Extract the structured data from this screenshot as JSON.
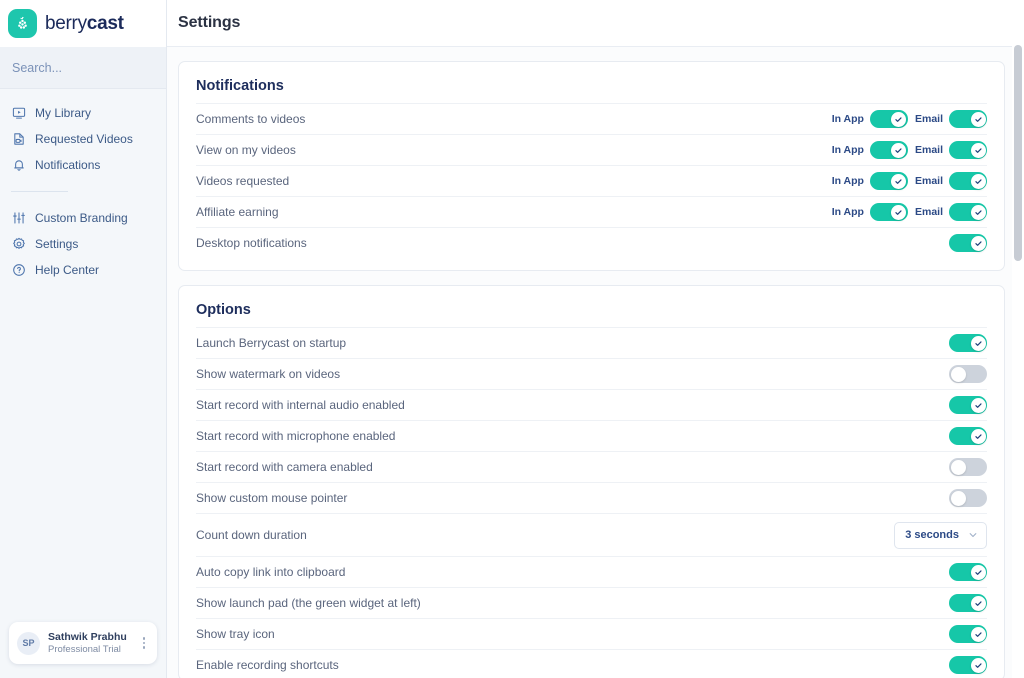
{
  "brand": {
    "name_light": "berry",
    "name_bold": "cast",
    "logo_icon": "grape-cluster-icon",
    "logo_color": "#1ec6ad"
  },
  "sidebar": {
    "search": {
      "placeholder": "Search...",
      "value": ""
    },
    "primary_items": [
      {
        "label": "My Library",
        "icon": "video-library-icon"
      },
      {
        "label": "Requested Videos",
        "icon": "requested-video-file-icon"
      },
      {
        "label": "Notifications",
        "icon": "bell-icon"
      }
    ],
    "secondary_items": [
      {
        "label": "Custom Branding",
        "icon": "sliders-icon"
      },
      {
        "label": "Settings",
        "icon": "gear-icon"
      },
      {
        "label": "Help Center",
        "icon": "question-circle-icon"
      }
    ],
    "profile": {
      "initials": "SP",
      "name": "Sathwik Prabhu",
      "plan": "Professional Trial",
      "menu_icon": "kebab-menu-icon"
    }
  },
  "header": {
    "title": "Settings"
  },
  "colors": {
    "accent_teal": "#16c7a8",
    "toggle_off": "#cdd3dc",
    "brand_navy": "#1d2d5c",
    "link_blue": "#2c4a86"
  },
  "notifications_card": {
    "title": "Notifications",
    "in_app_label": "In App",
    "email_label": "Email",
    "rows": [
      {
        "label": "Comments to videos",
        "in_app": true,
        "email": true,
        "has_channels": true
      },
      {
        "label": "View on my videos",
        "in_app": true,
        "email": true,
        "has_channels": true
      },
      {
        "label": "Videos requested",
        "in_app": true,
        "email": true,
        "has_channels": true
      },
      {
        "label": "Affiliate earning",
        "in_app": true,
        "email": true,
        "has_channels": true
      },
      {
        "label": "Desktop notifications",
        "enabled": true,
        "has_channels": false
      }
    ]
  },
  "options_card": {
    "title": "Options",
    "rows": [
      {
        "label": "Launch Berrycast on startup",
        "type": "toggle",
        "enabled": true
      },
      {
        "label": "Show watermark on videos",
        "type": "toggle",
        "enabled": false
      },
      {
        "label": "Start record with internal audio enabled",
        "type": "toggle",
        "enabled": true
      },
      {
        "label": "Start record with microphone enabled",
        "type": "toggle",
        "enabled": true
      },
      {
        "label": "Start record with camera enabled",
        "type": "toggle",
        "enabled": false
      },
      {
        "label": "Show custom mouse pointer",
        "type": "toggle",
        "enabled": false
      },
      {
        "label": "Count down duration",
        "type": "select",
        "value": "3 seconds"
      },
      {
        "label": "Auto copy link into clipboard",
        "type": "toggle",
        "enabled": true
      },
      {
        "label": "Show launch pad (the green widget at left)",
        "type": "toggle",
        "enabled": true
      },
      {
        "label": "Show tray icon",
        "type": "toggle",
        "enabled": true
      },
      {
        "label": "Enable recording shortcuts",
        "type": "toggle",
        "enabled": true
      }
    ]
  },
  "scrollbar": {
    "name": "vertical-scrollbar"
  }
}
